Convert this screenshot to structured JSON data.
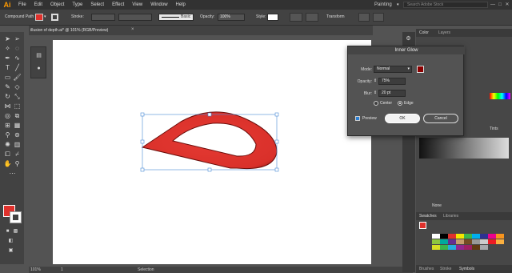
{
  "app": {
    "logo": "Ai",
    "workspace": "Painting",
    "search_placeholder": "Search Adobe Stock"
  },
  "menu": [
    "File",
    "Edit",
    "Object",
    "Type",
    "Select",
    "Effect",
    "View",
    "Window",
    "Help"
  ],
  "window_controls": {
    "minimize": "—",
    "maximize": "□",
    "close": "✕"
  },
  "control_bar": {
    "object_type": "Compound Path",
    "stroke_label": "Stroke:",
    "brush_label": "Basic",
    "opacity_label": "Opacity:",
    "opacity_value": "100%",
    "style_label": "Style:",
    "transform_label": "Transform"
  },
  "document": {
    "tab_label": "illusion of depth.ai* @ 101% (RGB/Preview)",
    "close": "×"
  },
  "status": {
    "zoom": "101%",
    "page": "1",
    "mode": "Selection"
  },
  "right_panel": {
    "tab_color": "Color",
    "tab_layers": "Layers",
    "tints_label": "Tints",
    "none_label": "None",
    "tab_swatches": "Swatches",
    "tab_libraries": "Libraries",
    "tab_brushes": "Brushes",
    "tab_stroke": "Stroke",
    "tab_symbols": "Symbols"
  },
  "dialog": {
    "title": "Inner Glow",
    "mode_label": "Mode:",
    "mode_value": "Normal",
    "opacity_label": "Opacity:",
    "opacity_value": "75%",
    "blur_label": "Blur:",
    "blur_value": "20 pt",
    "center_label": "Center",
    "edge_label": "Edge",
    "preview_label": "Preview",
    "ok_label": "OK",
    "cancel_label": "Cancel"
  },
  "colors": {
    "fill": "#e0312c",
    "glow": "#8b0000",
    "accent": "#ff9a00"
  },
  "icons": [
    "selection-arrow-icon",
    "direct-selection-icon",
    "pen-icon",
    "type-icon",
    "line-icon",
    "rectangle-icon",
    "paintbrush-icon",
    "pencil-icon",
    "eraser-icon",
    "rotate-icon",
    "scale-icon",
    "width-icon",
    "free-transform-icon",
    "shape-builder-icon",
    "perspective-icon",
    "mesh-icon",
    "gradient-icon",
    "eyedropper-icon",
    "blend-icon",
    "symbol-sprayer-icon",
    "graph-icon",
    "artboard-icon",
    "slice-icon",
    "hand-icon",
    "zoom-icon"
  ]
}
